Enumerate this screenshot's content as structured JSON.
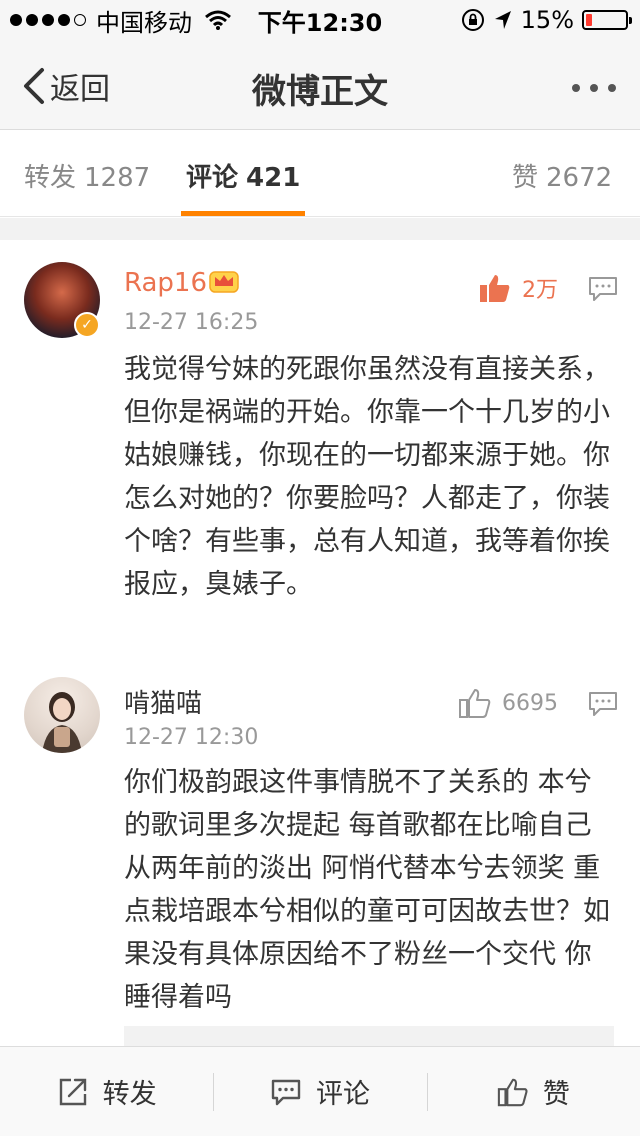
{
  "status_bar": {
    "carrier": "中国移动",
    "time": "下午12:30",
    "battery_percent": "15%",
    "battery_level": 0.15,
    "battery_color": "#ff3b30"
  },
  "nav": {
    "back_label": "返回",
    "title": "微博正文"
  },
  "tabs": [
    {
      "label": "转发",
      "count": "1287",
      "active": false
    },
    {
      "label": "评论",
      "count": "421",
      "active": true
    },
    {
      "label": "赞",
      "count": "2672",
      "active": false
    }
  ],
  "accent_color": "#ff8200",
  "comments": [
    {
      "username": "Rap16",
      "vip": true,
      "verified": true,
      "time": "12-27 16:25",
      "likes": "2万",
      "liked": true,
      "text": "我觉得兮妹的死跟你虽然没有直接关系，但你是祸端的开始。你靠一个十几岁的小姑娘赚钱，你现在的一切都来源于她。你怎么对她的？你要脸吗？人都走了，你装个啥？有些事，总有人知道，我等着你挨报应，臭婊子。"
    },
    {
      "username": "啃猫喵",
      "vip": false,
      "verified": false,
      "time": "12-27 12:30",
      "likes": "6695",
      "liked": false,
      "text": "你们极韵跟这件事情脱不了关系的 本兮的歌词里多次提起 每首歌都在比喻自己 从两年前的淡出 阿悄代替本兮去领奖 重点栽培跟本兮相似的童可可因故去世？如果没有具体原因给不了粉丝一个交代 你睡得着吗"
    }
  ],
  "toolbar": {
    "repost_label": "转发",
    "comment_label": "评论",
    "like_label": "赞"
  }
}
